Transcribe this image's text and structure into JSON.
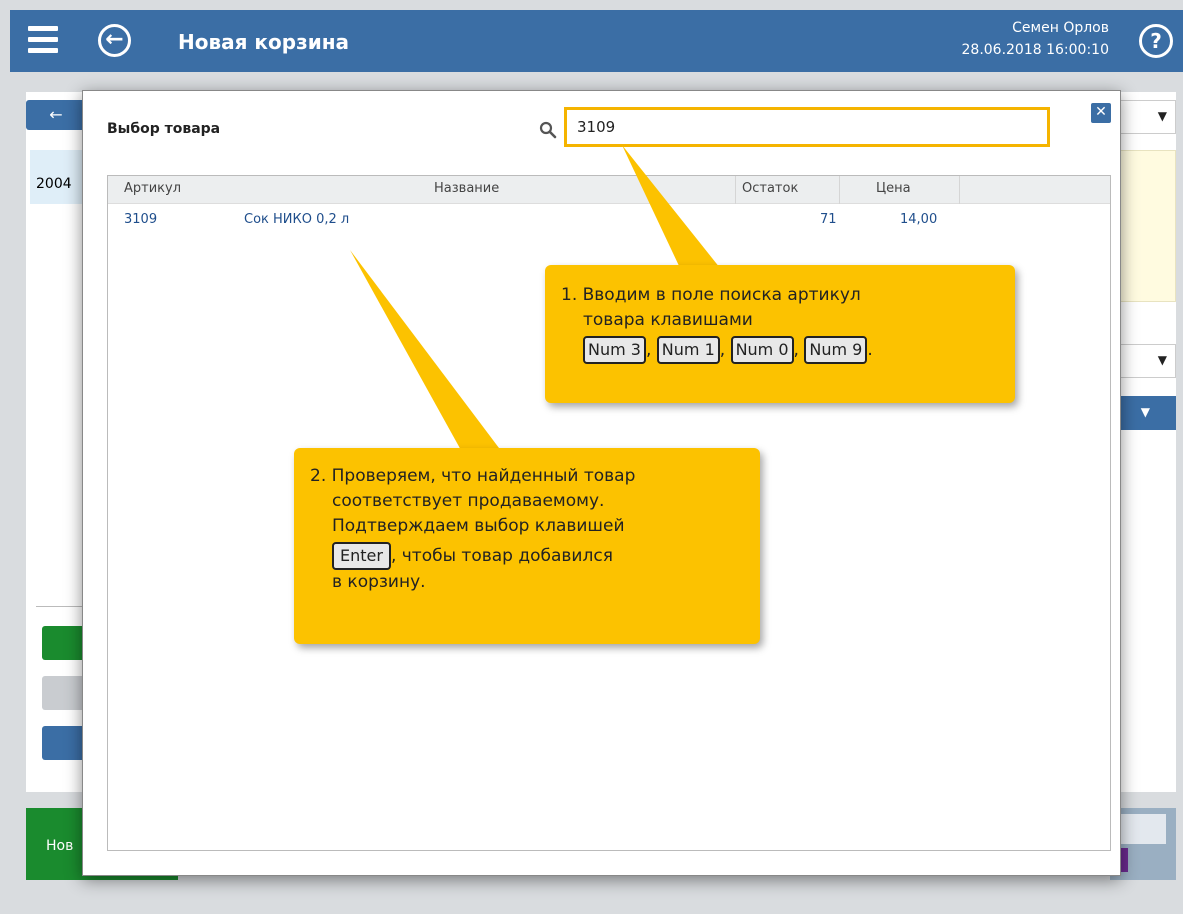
{
  "header": {
    "title": "Новая корзина",
    "user_name": "Семен Орлов",
    "datetime": "28.06.2018 16:00:10",
    "accent": "#3b6ea5"
  },
  "background": {
    "code_fragment": "2004",
    "new_button_fragment": "Нов",
    "back_arrow": "←"
  },
  "modal": {
    "title": "Выбор товара",
    "search_value": "3109",
    "close_label": "✕",
    "columns": [
      "Артикул",
      "Название",
      "Остаток",
      "Цена"
    ],
    "rows": [
      {
        "article": "3109",
        "name": "Сок НИКО 0,2 л",
        "stock": "71",
        "price": "14,00"
      }
    ]
  },
  "callouts": {
    "c1_line1": "1. Вводим в поле поиска артикул",
    "c1_line2": "товара клавишами",
    "c1_keys": [
      "Num 3",
      "Num 1",
      "Num 0",
      "Num 9"
    ],
    "c2_line1": "2. Проверяем, что найденный товар",
    "c2_line2": "соответствует продаваемому.",
    "c2_line3": "Подтверждаем выбор клавишей",
    "c2_key": "Enter",
    "c2_line4_rest": ", чтобы товар добавился",
    "c2_line5": "в корзину.",
    "color": "#fcc200"
  }
}
